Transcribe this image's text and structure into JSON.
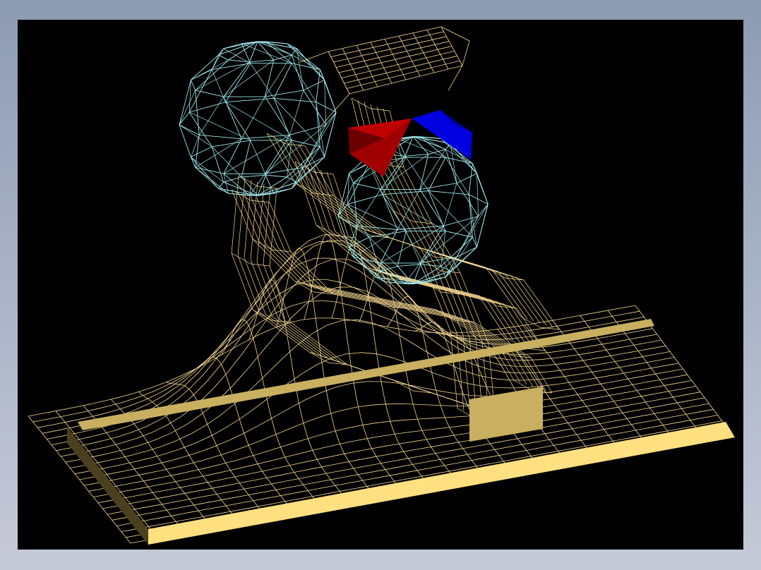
{
  "scene": {
    "background": "#000000",
    "wire_color": "#f5d890",
    "sphere_color": "#9fe6ea",
    "red_shape_color": "#b00000",
    "blue_shape_color": "#0000e0",
    "base_plate_color": "#ffe080",
    "gold_panel_color": "#c8b060"
  }
}
